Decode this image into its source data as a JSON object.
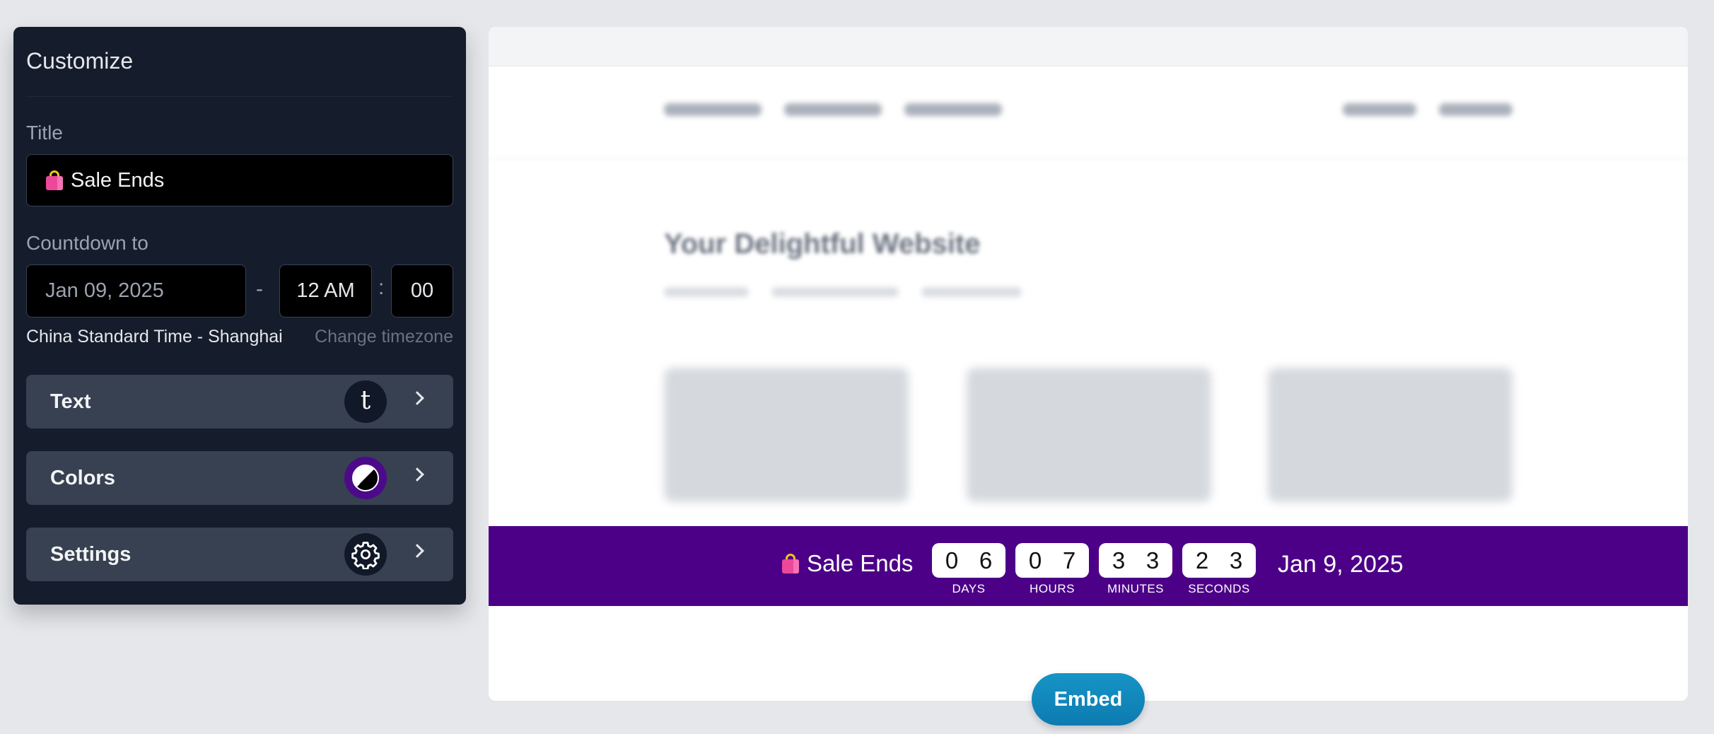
{
  "panel": {
    "title": "Customize",
    "title_label": "Title",
    "title_value": "Sale Ends",
    "countdown_label": "Countdown to",
    "date_value": "Jan 09, 2025",
    "dash": "-",
    "hour_value": "12 AM",
    "colon": ":",
    "minute_value": "00",
    "timezone": "China Standard Time - Shanghai",
    "change_timezone": "Change timezone",
    "rows": [
      {
        "label": "Text",
        "icon": "text-style-icon",
        "glyph": "t"
      },
      {
        "label": "Colors",
        "icon": "contrast-icon"
      },
      {
        "label": "Settings",
        "icon": "gear-icon"
      }
    ]
  },
  "preview": {
    "site_title": "Your Delightful Website",
    "bar": {
      "title": "Sale Ends",
      "background": "#4c0087",
      "units": [
        {
          "digits": [
            "0",
            "6"
          ],
          "label": "DAYS"
        },
        {
          "digits": [
            "0",
            "7"
          ],
          "label": "HOURS"
        },
        {
          "digits": [
            "3",
            "3"
          ],
          "label": "MINUTES"
        },
        {
          "digits": [
            "2",
            "3"
          ],
          "label": "SECONDS"
        }
      ],
      "date": "Jan 9, 2025"
    }
  },
  "embed_label": "Embed"
}
